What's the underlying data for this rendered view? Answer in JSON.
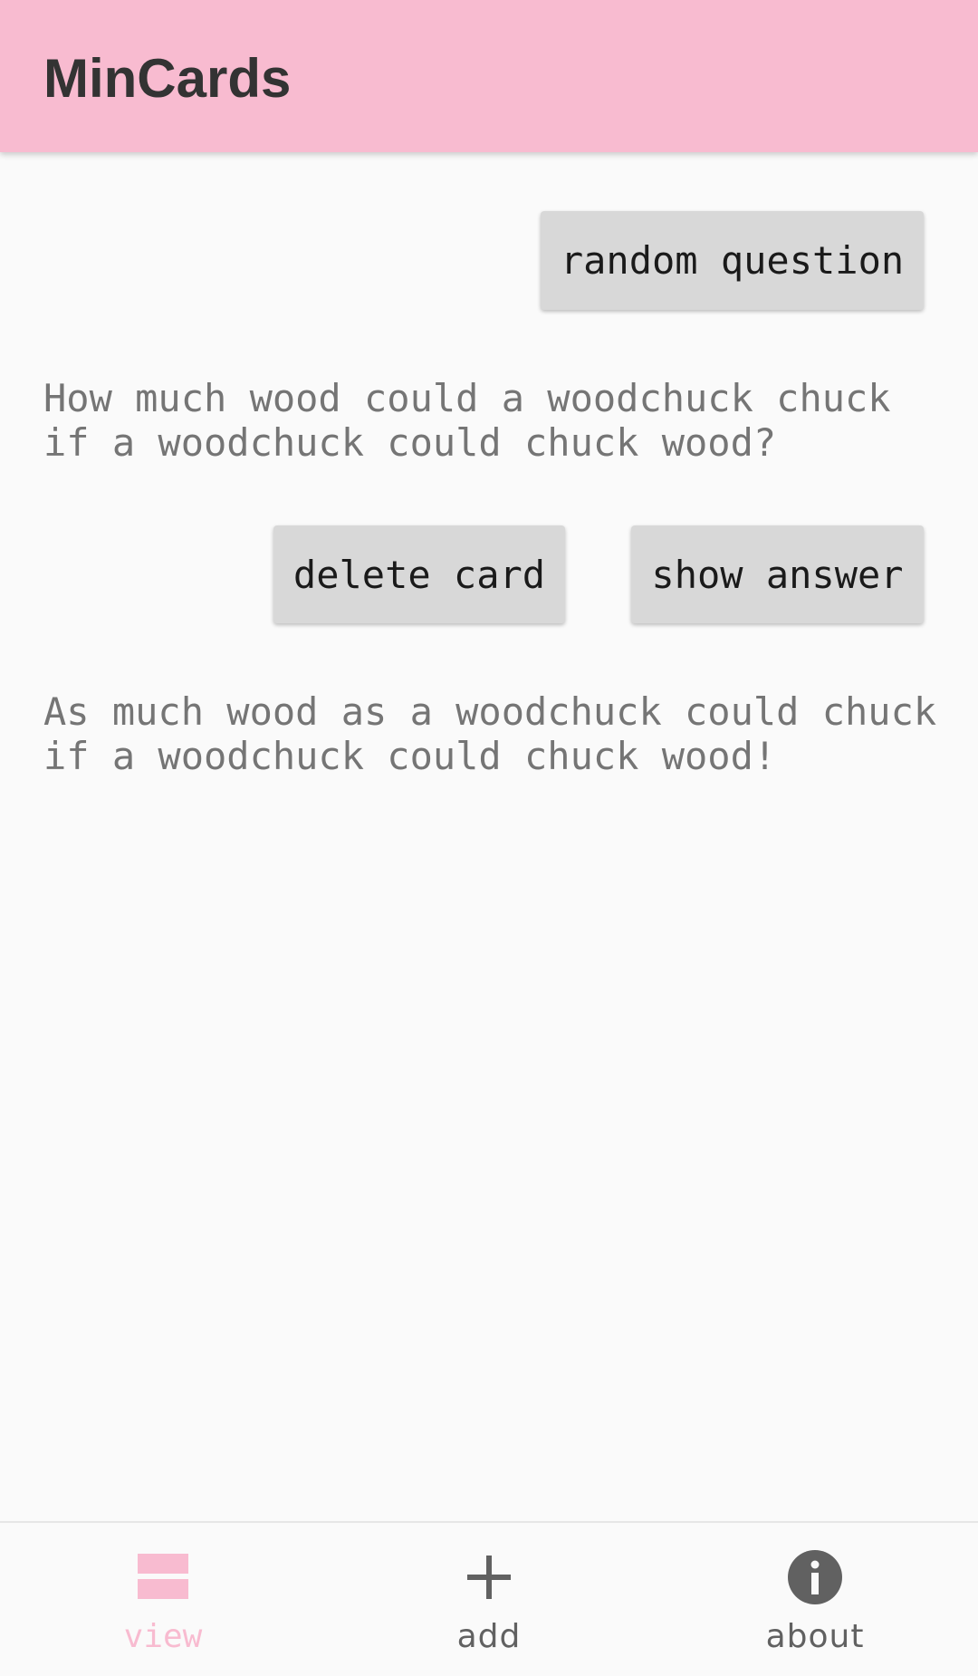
{
  "app": {
    "title": "MinCards"
  },
  "actions": {
    "random_label": "random question",
    "delete_label": "delete card",
    "show_answer_label": "show answer"
  },
  "card": {
    "question": "How much wood could a woodchuck chuck\nif a woodchuck could chuck wood?",
    "answer": "As much wood as a woodchuck could chuck\nif a woodchuck could chuck wood!"
  },
  "nav": {
    "items": [
      {
        "label": "view",
        "icon": "view-list-icon",
        "active": true
      },
      {
        "label": "add",
        "icon": "plus-icon",
        "active": false
      },
      {
        "label": "about",
        "icon": "info-icon",
        "active": false
      }
    ]
  },
  "colors": {
    "accent": "#f8bbd0",
    "app_bar_text": "#333333",
    "button_bg": "#d8d8d8",
    "card_text": "#757575",
    "inactive_nav": "#616161",
    "background": "#fafafa"
  }
}
